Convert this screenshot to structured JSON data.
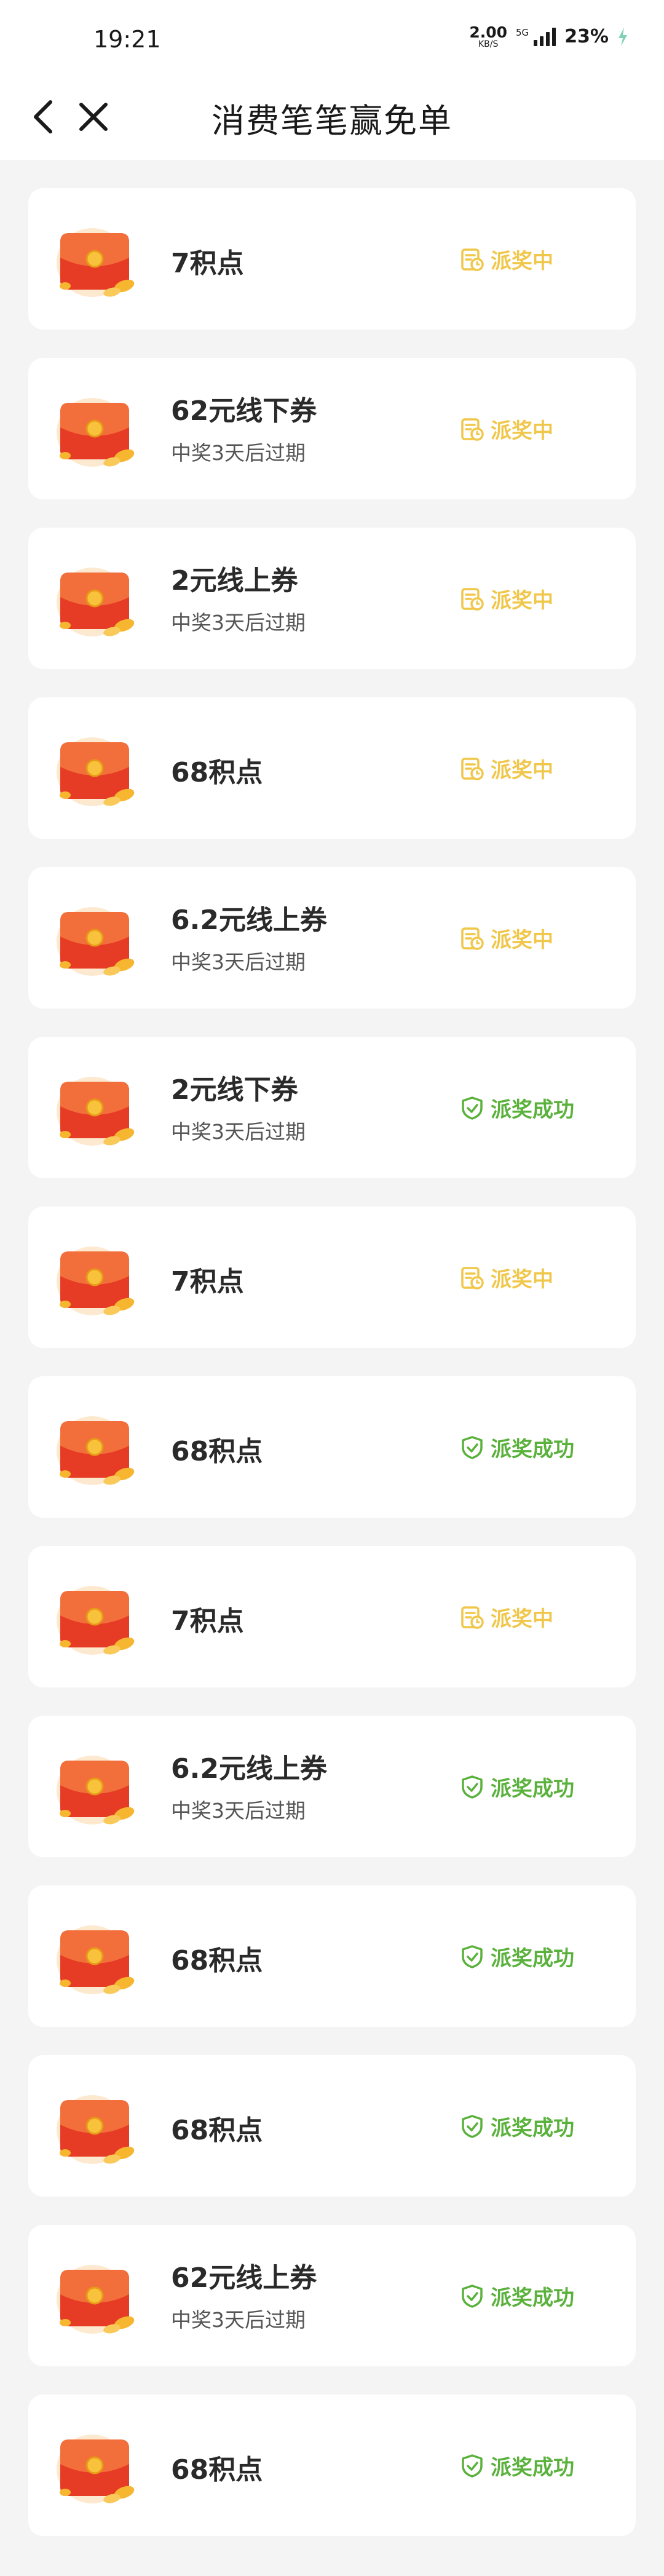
{
  "status_bar": {
    "time": "19:21",
    "net_speed": "2.00",
    "net_unit": "KB/S",
    "signal": "5G",
    "battery": "23%"
  },
  "nav": {
    "title": "消费笔笔赢免单",
    "back_icon": "chevron-left-icon",
    "close_icon": "close-icon"
  },
  "colors": {
    "pending": "#f0c74a",
    "success": "#5ab13c",
    "envelope": "#e8412a"
  },
  "prizes": [
    {
      "name": "7积点",
      "note": "",
      "status": "pending",
      "status_label": "派奖中"
    },
    {
      "name": "62元线下券",
      "note": "中奖3天后过期",
      "status": "pending",
      "status_label": "派奖中"
    },
    {
      "name": "2元线上券",
      "note": "中奖3天后过期",
      "status": "pending",
      "status_label": "派奖中"
    },
    {
      "name": "68积点",
      "note": "",
      "status": "pending",
      "status_label": "派奖中"
    },
    {
      "name": "6.2元线上券",
      "note": "中奖3天后过期",
      "status": "pending",
      "status_label": "派奖中"
    },
    {
      "name": "2元线下券",
      "note": "中奖3天后过期",
      "status": "success",
      "status_label": "派奖成功"
    },
    {
      "name": "7积点",
      "note": "",
      "status": "pending",
      "status_label": "派奖中"
    },
    {
      "name": "68积点",
      "note": "",
      "status": "success",
      "status_label": "派奖成功"
    },
    {
      "name": "7积点",
      "note": "",
      "status": "pending",
      "status_label": "派奖中"
    },
    {
      "name": "6.2元线上券",
      "note": "中奖3天后过期",
      "status": "success",
      "status_label": "派奖成功"
    },
    {
      "name": "68积点",
      "note": "",
      "status": "success",
      "status_label": "派奖成功"
    },
    {
      "name": "68积点",
      "note": "",
      "status": "success",
      "status_label": "派奖成功"
    },
    {
      "name": "62元线上券",
      "note": "中奖3天后过期",
      "status": "success",
      "status_label": "派奖成功"
    },
    {
      "name": "68积点",
      "note": "",
      "status": "success",
      "status_label": "派奖成功"
    }
  ]
}
